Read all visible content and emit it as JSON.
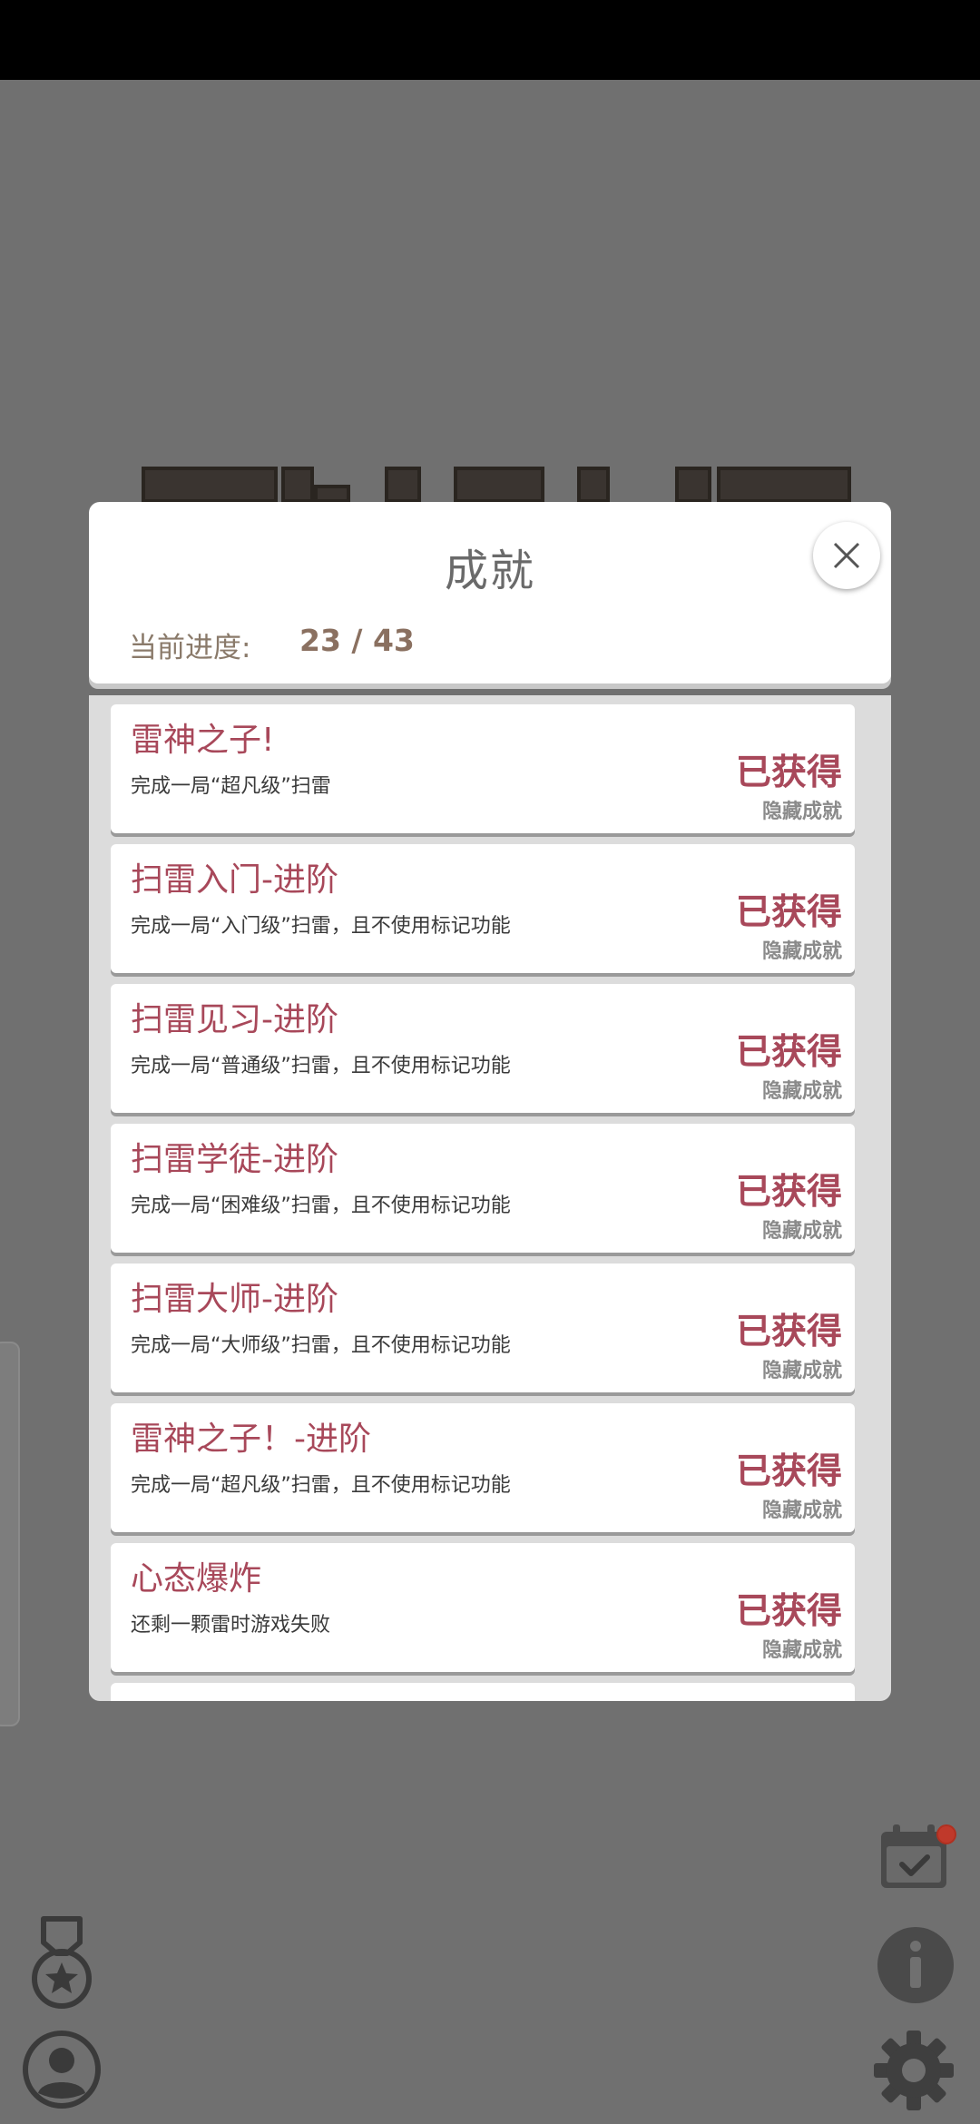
{
  "modal": {
    "title": "成就",
    "progress_label": "当前进度:",
    "progress_value": "23 / 43"
  },
  "achievements": [
    {
      "title": "雷神之子!",
      "desc": "完成一局“超凡级”扫雷",
      "status": "已获得",
      "tag": "隐藏成就"
    },
    {
      "title": "扫雷入门-进阶",
      "desc": "完成一局“入门级”扫雷，且不使用标记功能",
      "status": "已获得",
      "tag": "隐藏成就"
    },
    {
      "title": "扫雷见习-进阶",
      "desc": "完成一局“普通级”扫雷，且不使用标记功能",
      "status": "已获得",
      "tag": "隐藏成就"
    },
    {
      "title": "扫雷学徒-进阶",
      "desc": "完成一局“困难级”扫雷，且不使用标记功能",
      "status": "已获得",
      "tag": "隐藏成就"
    },
    {
      "title": "扫雷大师-进阶",
      "desc": "完成一局“大师级”扫雷，且不使用标记功能",
      "status": "已获得",
      "tag": "隐藏成就"
    },
    {
      "title": "雷神之子！-进阶",
      "desc": "完成一局“超凡级”扫雷，且不使用标记功能",
      "status": "已获得",
      "tag": "隐藏成就"
    },
    {
      "title": "心态爆炸",
      "desc": "还剩一颗雷时游戏失败",
      "status": "已获得",
      "tag": "隐藏成就"
    }
  ],
  "icons": {
    "close": "close-icon",
    "calendar": "calendar-check-icon",
    "info": "info-icon",
    "settings": "gear-icon",
    "medal": "medal-star-icon",
    "profile": "user-icon"
  },
  "colors": {
    "accent": "#a8485a",
    "overlay": "#707070",
    "list_bg": "#dcdcdc"
  }
}
